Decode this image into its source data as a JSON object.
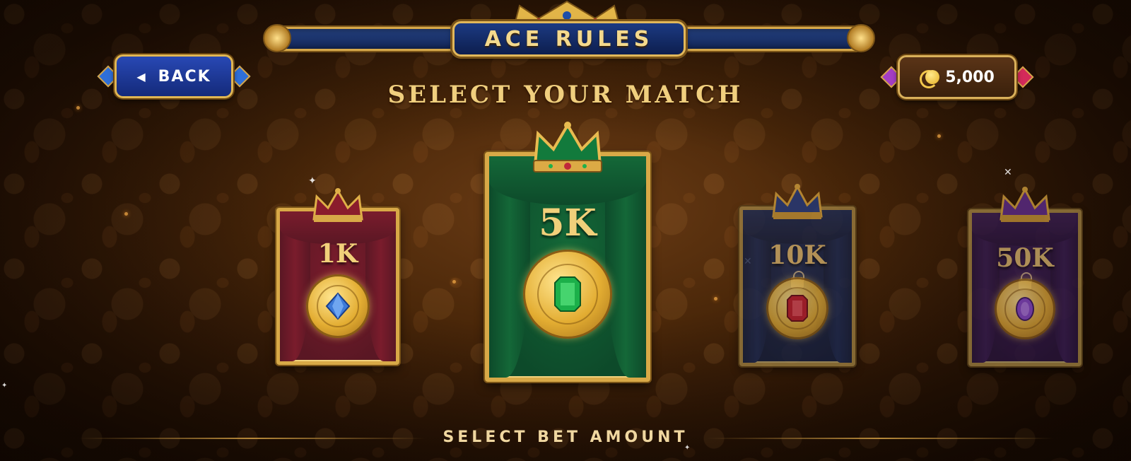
{
  "header": {
    "title": "ACE RULES",
    "subtitle": "SELECT YOUR MATCH"
  },
  "back_button": {
    "label": "BACK",
    "icon": "left-arrow-icon"
  },
  "balance": {
    "icon": "coins-icon",
    "value": "5,000"
  },
  "cards": [
    {
      "amount": "1K",
      "theme": "red",
      "gem": "blue-diamond",
      "locked": false,
      "selected": false,
      "colors": {
        "bg": "#5a1724",
        "curtain": "#7a1c2c",
        "gem": "#3d7ad8"
      }
    },
    {
      "amount": "5K",
      "theme": "green",
      "gem": "emerald",
      "locked": false,
      "selected": true,
      "colors": {
        "bg": "#0d4a2a",
        "curtain": "#146838",
        "gem": "#1cb04a"
      }
    },
    {
      "amount": "10K",
      "theme": "blue",
      "gem": "ruby",
      "locked": true,
      "selected": false,
      "colors": {
        "bg": "#1a2a5a",
        "curtain": "#22387a",
        "gem": "#c81c2c"
      }
    },
    {
      "amount": "50K",
      "theme": "purple",
      "gem": "amethyst",
      "locked": true,
      "selected": false,
      "colors": {
        "bg": "#3a1a5a",
        "curtain": "#4e2478",
        "gem": "#8a4ad0"
      }
    }
  ],
  "footer": {
    "label": "SELECT BET AMOUNT"
  },
  "colors": {
    "gold": "#d8a947",
    "gold_text": "#f1d07a",
    "button_blue": "#1c3a9a",
    "background": "#4a2709"
  }
}
